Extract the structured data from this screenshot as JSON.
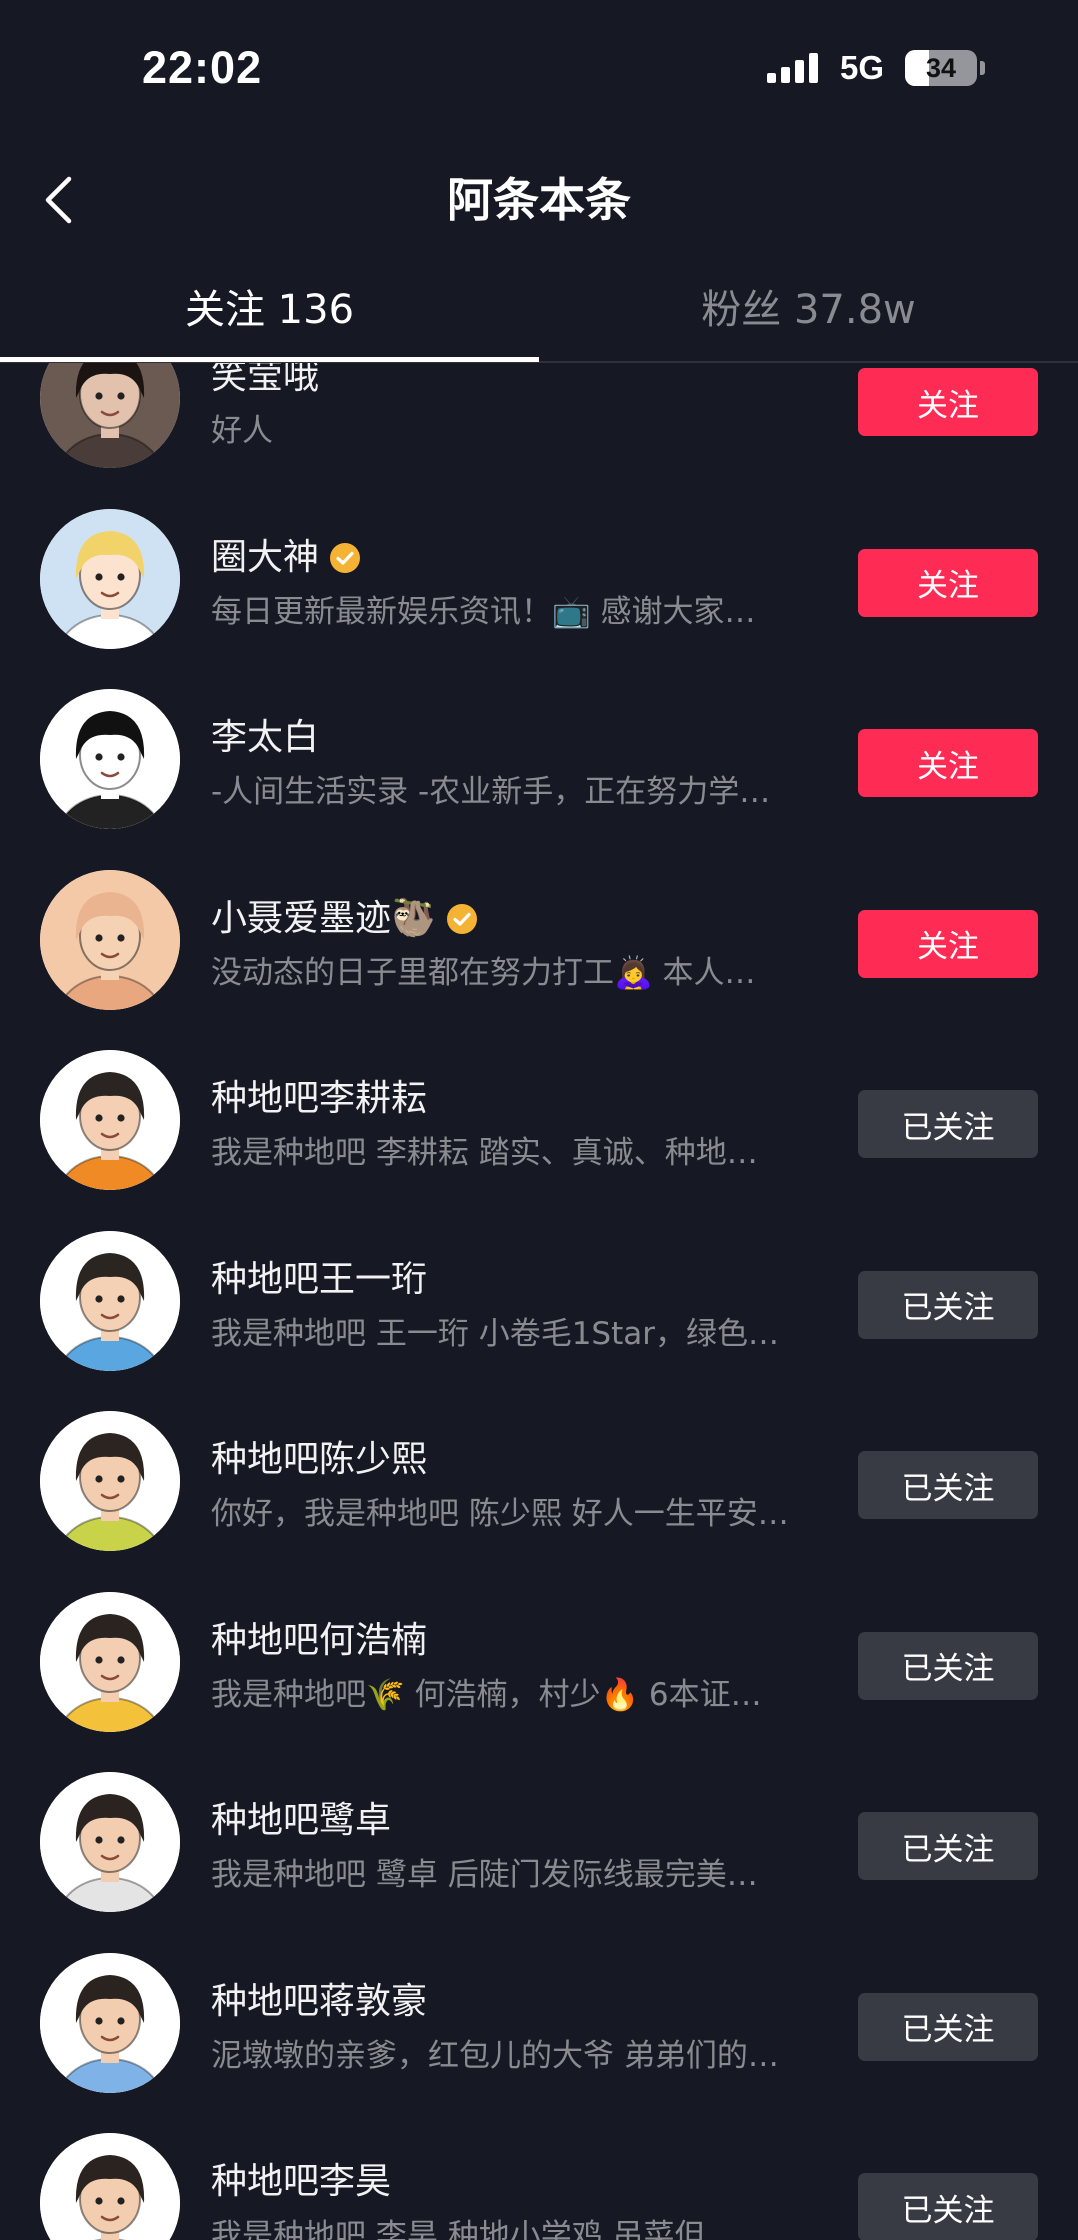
{
  "status_bar": {
    "time": "22:02",
    "network": "5G",
    "battery_text": "34",
    "battery_level": 34,
    "signal_level": 4,
    "signal_icon": "cellular-signal-icon",
    "battery_icon": "battery-icon"
  },
  "header": {
    "back_icon": "chevron-left-icon",
    "title": "阿条本条"
  },
  "tabs": [
    {
      "label": "关注 136",
      "active": true
    },
    {
      "label": "粉丝 37.8w",
      "active": false
    }
  ],
  "theme": {
    "background": "#161823",
    "follow_button": "#fe2c55",
    "following_button": "#393b44",
    "text_primary": "#f2f2f3",
    "text_secondary": "#8a8b91",
    "verified_badge": "#f5b335",
    "verified_icon": "verified-check-icon"
  },
  "list": {
    "items": [
      {
        "name": "笑莹哦",
        "verified": false,
        "description": "好人",
        "button_label": "关注",
        "following": false,
        "avatar": {
          "bg": "#6b5a52",
          "hair": "#1b1412",
          "skin": "#e2c1ad",
          "shirt": "#4a3c38"
        }
      },
      {
        "name": "圈大神",
        "verified": true,
        "description": "每日更新最新娱乐资讯！📺 感谢大家…",
        "button_label": "关注",
        "following": false,
        "avatar": {
          "bg": "#cfe2f3",
          "hair": "#f2d36a",
          "skin": "#fbe3d0",
          "shirt": "#ffffff"
        }
      },
      {
        "name": "李太白",
        "verified": false,
        "description": "-人间生活实录 -农业新手，正在努力学…",
        "button_label": "关注",
        "following": false,
        "avatar": {
          "bg": "#ffffff",
          "hair": "#111111",
          "skin": "#ffffff",
          "shirt": "#222222"
        }
      },
      {
        "name": "小聂爱墨迹🦥",
        "verified": true,
        "description": "没动态的日子里都在努力打工🙇‍♀️ 本人…",
        "button_label": "关注",
        "following": false,
        "avatar": {
          "bg": "#f3c9a8",
          "hair": "#e9b48f",
          "skin": "#f6d2b4",
          "shirt": "#e8a77f"
        }
      },
      {
        "name": "种地吧李耕耘",
        "verified": false,
        "description": "我是种地吧 李耕耘 踏实、真诚、种地…",
        "button_label": "已关注",
        "following": true,
        "avatar": {
          "bg": "#ffffff",
          "hair": "#2a2422",
          "skin": "#f4cfb4",
          "shirt": "#f08a24"
        }
      },
      {
        "name": "种地吧王一珩",
        "verified": false,
        "description": "我是种地吧 王一珩 小卷毛1Star，绿色…",
        "button_label": "已关注",
        "following": true,
        "avatar": {
          "bg": "#ffffff",
          "hair": "#2b2522",
          "skin": "#f4d0b5",
          "shirt": "#5aa6e0"
        }
      },
      {
        "name": "种地吧陈少熙",
        "verified": false,
        "description": "你好，我是种地吧 陈少熙 好人一生平安…",
        "button_label": "已关注",
        "following": true,
        "avatar": {
          "bg": "#ffffff",
          "hair": "#2c2420",
          "skin": "#f2cdb0",
          "shirt": "#c9d34a"
        }
      },
      {
        "name": "种地吧何浩楠",
        "verified": false,
        "description": "我是种地吧🌾 何浩楠，村少🔥 6本证…",
        "button_label": "已关注",
        "following": true,
        "avatar": {
          "bg": "#ffffff",
          "hair": "#2a2320",
          "skin": "#f3ceb2",
          "shirt": "#f4c23a"
        }
      },
      {
        "name": "种地吧鹭卓",
        "verified": false,
        "description": "我是种地吧 鹭卓 后陡门发际线最完美…",
        "button_label": "已关注",
        "following": true,
        "avatar": {
          "bg": "#ffffff",
          "hair": "#2a2320",
          "skin": "#f3cdb0",
          "shirt": "#e4e4e4"
        }
      },
      {
        "name": "种地吧蒋敦豪",
        "verified": false,
        "description": "泥墩墩的亲爹，红包儿的大爷 弟弟们的…",
        "button_label": "已关注",
        "following": true,
        "avatar": {
          "bg": "#ffffff",
          "hair": "#2a2320",
          "skin": "#f3cdb0",
          "shirt": "#7fb3e8"
        }
      },
      {
        "name": "种地吧李昊",
        "verified": false,
        "description": "我是种地吧 李昊 种地小学鸡 吊菜但",
        "button_label": "已关注",
        "following": true,
        "avatar": {
          "bg": "#ffffff",
          "hair": "#2a2320",
          "skin": "#f3cdb0",
          "shirt": "#9aa9c7"
        }
      }
    ]
  }
}
